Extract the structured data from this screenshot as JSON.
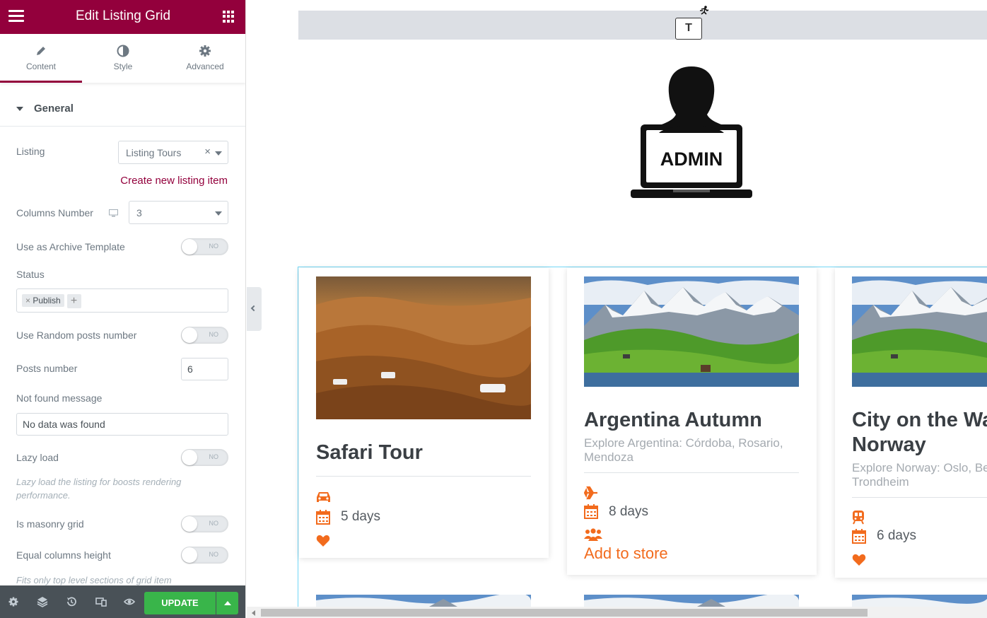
{
  "panel": {
    "title": "Edit Listing Grid",
    "tabs": [
      {
        "label": "Content",
        "icon": "pencil-icon"
      },
      {
        "label": "Style",
        "icon": "half-circle-icon"
      },
      {
        "label": "Advanced",
        "icon": "gear-icon"
      }
    ],
    "section": "General",
    "listing_label": "Listing",
    "listing_value": "Listing Tours",
    "create_link": "Create new listing item",
    "columns_label": "Columns Number",
    "columns_value": "3",
    "archive_label": "Use as Archive Template",
    "status_label": "Status",
    "status_tag": "Publish",
    "random_label": "Use Random posts number",
    "posts_label": "Posts number",
    "posts_value": "6",
    "notfound_label": "Not found message",
    "notfound_value": "No data was found",
    "lazy_label": "Lazy load",
    "lazy_hint": "Lazy load the listing for boosts rendering performance.",
    "masonry_label": "Is masonry grid",
    "equal_label": "Equal columns height",
    "equal_hint": "Fits only top level sections of grid item",
    "toggle_off": "NO",
    "update": "UPDATE"
  },
  "preview": {
    "edit_button": "T",
    "admin_text": "ADMIN",
    "cards": [
      {
        "title": "Safari Tour",
        "subtitle": "",
        "days": "5 days",
        "transport": "car-icon",
        "extra": ""
      },
      {
        "title": "Argentina Autumn",
        "subtitle": "Explore Argentina: Córdoba, Rosario,",
        "subtitle2": "Mendoza",
        "days": "8 days",
        "transport": "plane-icon",
        "extra": "Add to store"
      },
      {
        "title": "City on the Wa",
        "title2": "Norway",
        "subtitle": "Explore Norway: Oslo, Be",
        "subtitle2": "Trondheim",
        "days": "6 days",
        "transport": "train-icon",
        "extra": ""
      }
    ]
  },
  "colors": {
    "brand": "#93003c",
    "accent": "#f26b1d",
    "update": "#39b54a"
  }
}
